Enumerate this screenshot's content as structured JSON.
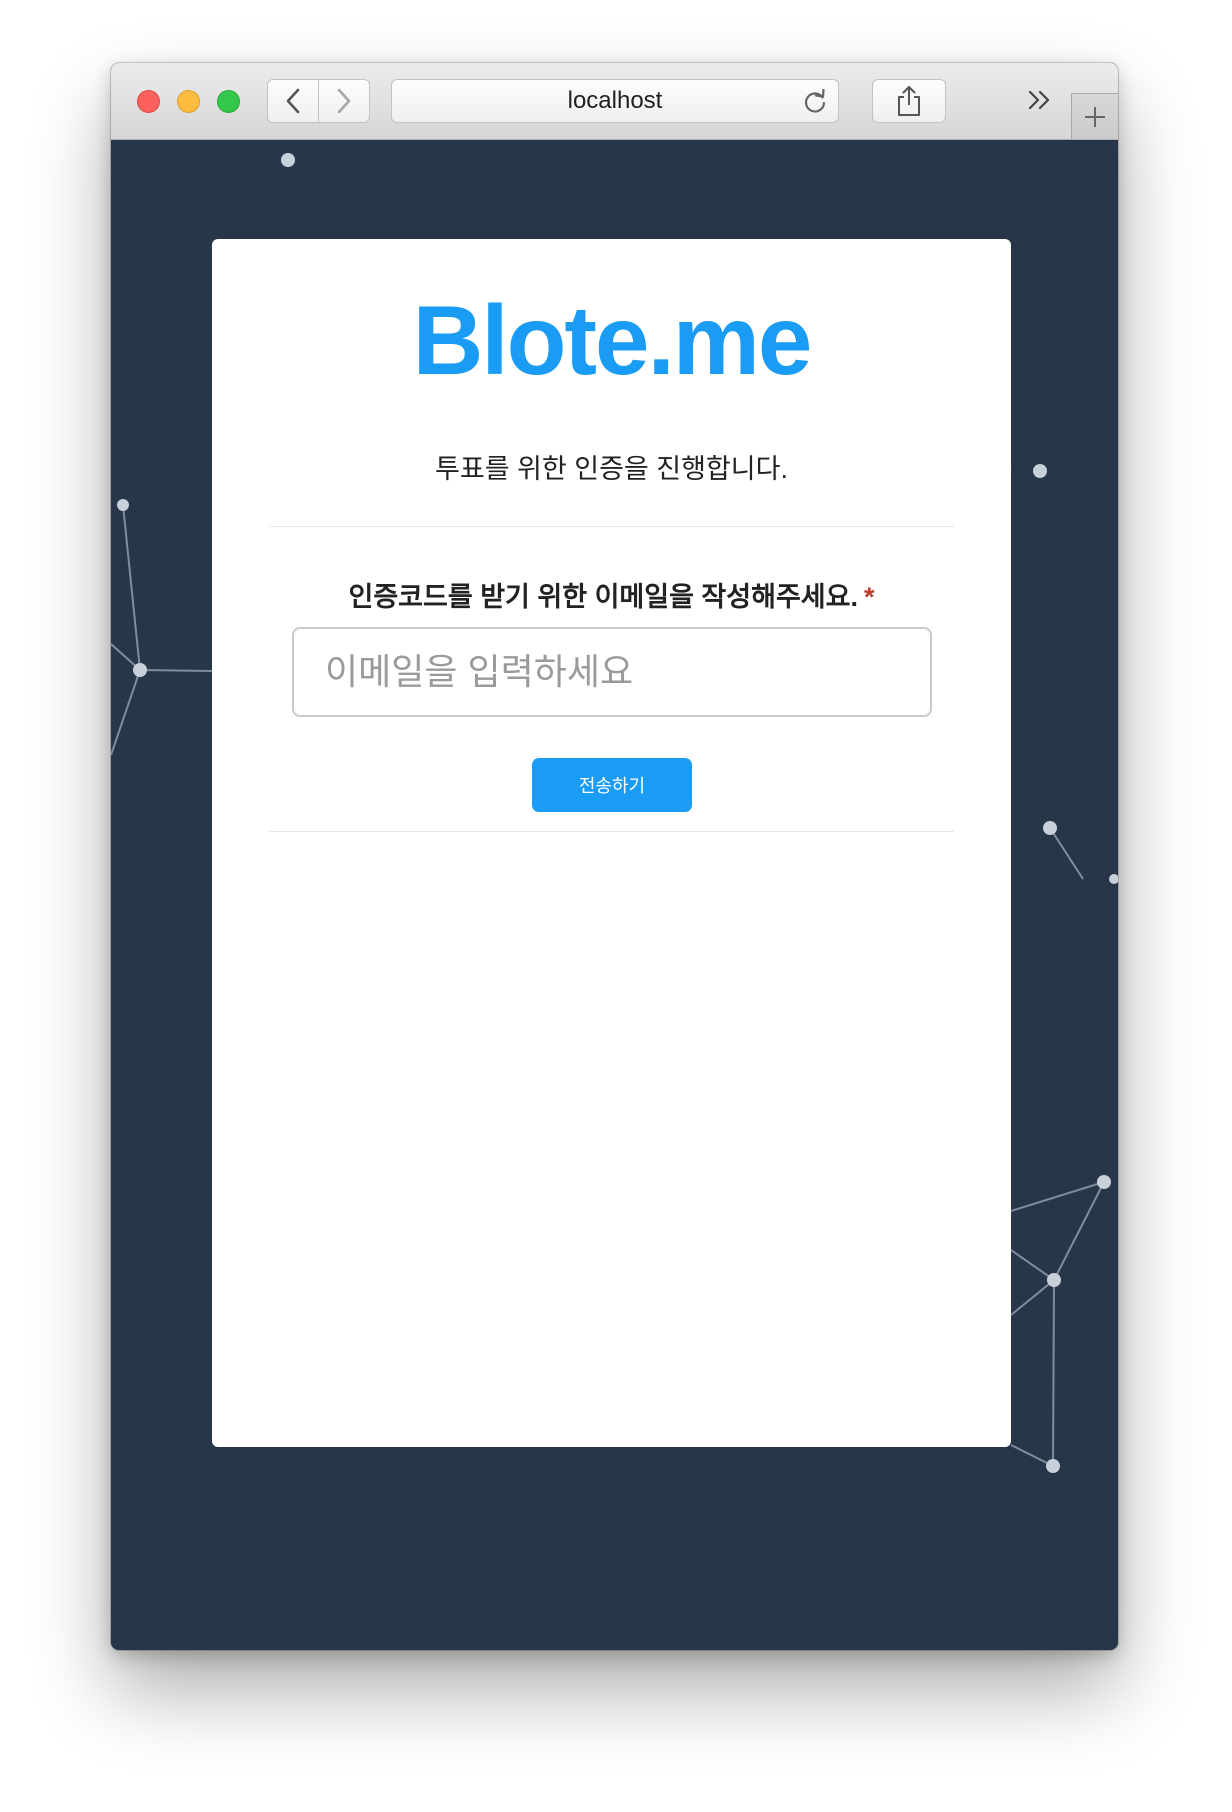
{
  "browser": {
    "address": "localhost",
    "icons": {
      "back": "chevron-left-icon",
      "forward": "chevron-right-icon",
      "reload": "reload-icon",
      "share": "share-icon",
      "overflow": "double-chevron-right-icon",
      "new_tab": "plus-icon"
    }
  },
  "page": {
    "logo": "Blote.me",
    "subtitle": "투표를 위한 인증을 진행합니다.",
    "form": {
      "label": "인증코드를 받기 위한 이메일을 작성해주세요.",
      "required_mark": "*",
      "email_placeholder": "이메일을 입력하세요",
      "email_value": "",
      "submit_label": "전송하기"
    }
  },
  "colors": {
    "brand": "#1a9cf4",
    "background": "#283649",
    "required": "#c0392b"
  }
}
